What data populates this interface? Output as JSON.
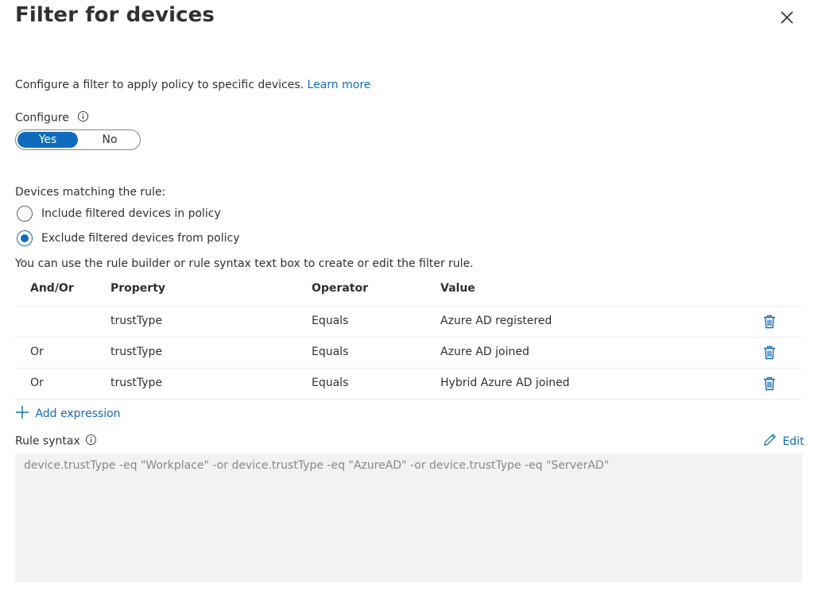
{
  "header": {
    "title": "Filter for devices"
  },
  "intro": {
    "text": "Configure a filter to apply policy to specific devices.",
    "learn_more": "Learn more"
  },
  "configure": {
    "label": "Configure",
    "yes": "Yes",
    "no": "No",
    "selected": "Yes"
  },
  "matching": {
    "label": "Devices matching the rule:",
    "options": [
      {
        "label": "Include filtered devices in policy",
        "checked": false
      },
      {
        "label": "Exclude filtered devices from policy",
        "checked": true
      }
    ]
  },
  "hint": "You can use the rule builder or rule syntax text box to create or edit the filter rule.",
  "table": {
    "headers": [
      "And/Or",
      "Property",
      "Operator",
      "Value"
    ],
    "rows": [
      {
        "andor": "",
        "property": "trustType",
        "operator": "Equals",
        "value": "Azure AD registered"
      },
      {
        "andor": "Or",
        "property": "trustType",
        "operator": "Equals",
        "value": "Azure AD joined"
      },
      {
        "andor": "Or",
        "property": "trustType",
        "operator": "Equals",
        "value": "Hybrid Azure AD joined"
      }
    ]
  },
  "add_expression": "Add expression",
  "rule_syntax": {
    "label": "Rule syntax",
    "edit": "Edit",
    "text": "device.trustType -eq \"Workplace\" -or device.trustType -eq \"AzureAD\" -or device.trustType -eq \"ServerAD\""
  },
  "colors": {
    "accent": "#0f6cbd",
    "text": "#323130",
    "muted": "#8a8886",
    "box": "#f3f2f1"
  }
}
